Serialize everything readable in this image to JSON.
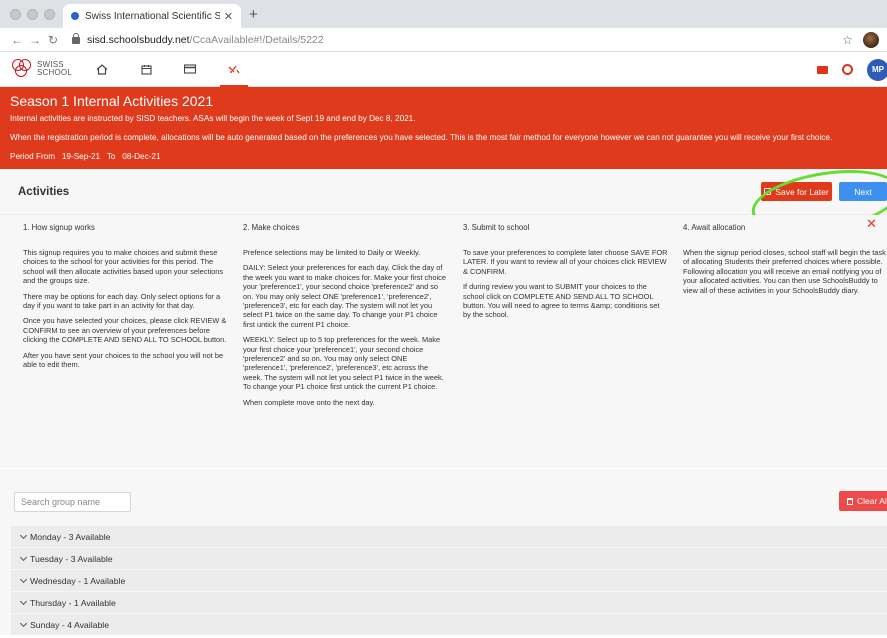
{
  "browser": {
    "tab_title": "Swiss International Scientific S",
    "url_host": "sisd.schoolsbuddy.net",
    "url_path": "/CcaAvailable#!/Details/5222"
  },
  "header": {
    "logo_line1": "SWISS",
    "logo_line2": "SCHOOL",
    "avatar_initials": "MP"
  },
  "banner": {
    "title": "Season 1 Internal Activities 2021",
    "line1": "Internal activities are instructed by SISD teachers.  ASAs will begin the week of Sept 19 and end by Dec 8, 2021.",
    "line2": "When the registration period is complete, allocations will be auto generated based on the preferences you have selected.  This is the most fair method for everyone however we can not guarantee you will receive your first choice.",
    "period_label": "Period From",
    "from": "19-Sep-21",
    "to_label": "To",
    "to": "08-Dec-21"
  },
  "activities": {
    "title": "Activities",
    "save_label": "Save for Later",
    "next_label": "Next"
  },
  "steps": [
    {
      "title": "1. How signup works",
      "paragraphs": [
        "This signup requires you to make choices and submit these choices to the school for your activities for this period. The school will then allocate activities based upon your selections and the groups size.",
        "There may be options for each day. Only select options for a day if you want to take part in an activity for that day.",
        "Once you have selected your choices, please click REVIEW & CONFIRM to see an overview of your preferences before clicking the COMPLETE AND SEND ALL TO SCHOOL button.",
        "After you have sent your choices to the school you will not be able to edit them."
      ]
    },
    {
      "title": "2. Make choices",
      "paragraphs": [
        "Prefence selections may be limited to Daily or Weekly.",
        "DAILY: Select your preferences for each day. Click the day of the week you want to make choices for. Make your first choice your 'preference1', your second choice 'preference2' and so on. You may only select ONE 'preference1', 'preference2', 'preference3', etc for each day. The system will not let you select P1 twice on the same day. To change your P1 choice first untick the current P1 choice.",
        "WEEKLY: Select up to 5 top preferences for the week. Make your first choice your 'preference1', your second choice 'preference2' and so on. You may only select ONE 'preference1', 'preference2', 'preference3', etc across the week. The system will not let you select P1 twice in the week. To change your P1 choice first untick the current P1 choice.",
        "When complete move onto the next day."
      ]
    },
    {
      "title": "3. Submit to school",
      "paragraphs": [
        "To save your preferences to complete later choose SAVE FOR LATER. If you want to review all of your choices click REVIEW & CONFIRM.",
        "If during review you want to SUBMIT your choices to the school click on COMPLETE AND SEND ALL TO SCHOOL button. You will need to agree to terms &amp; conditions set by the school."
      ]
    },
    {
      "title": "4. Await allocation",
      "paragraphs": [
        "When the signup period closes, school staff will begin the task of allocating Students their preferred choices where possible. Following allocation you will receive an email notifying you of your allocated activities. You can then use SchoolsBuddy to view all of these activities in your SchoolsBuddy diary."
      ]
    }
  ],
  "search": {
    "placeholder": "Search group name",
    "clear_label": "Clear All"
  },
  "days": [
    "Monday - 3 Available",
    "Tuesday - 3 Available",
    "Wednesday - 1 Available",
    "Thursday - 1 Available",
    "Sunday - 4 Available"
  ],
  "colors": {
    "brand_red": "#e03a1d",
    "next_blue": "#3d8ff0",
    "clear_red": "#ee4a4a",
    "highlight_green": "#66dd33"
  }
}
